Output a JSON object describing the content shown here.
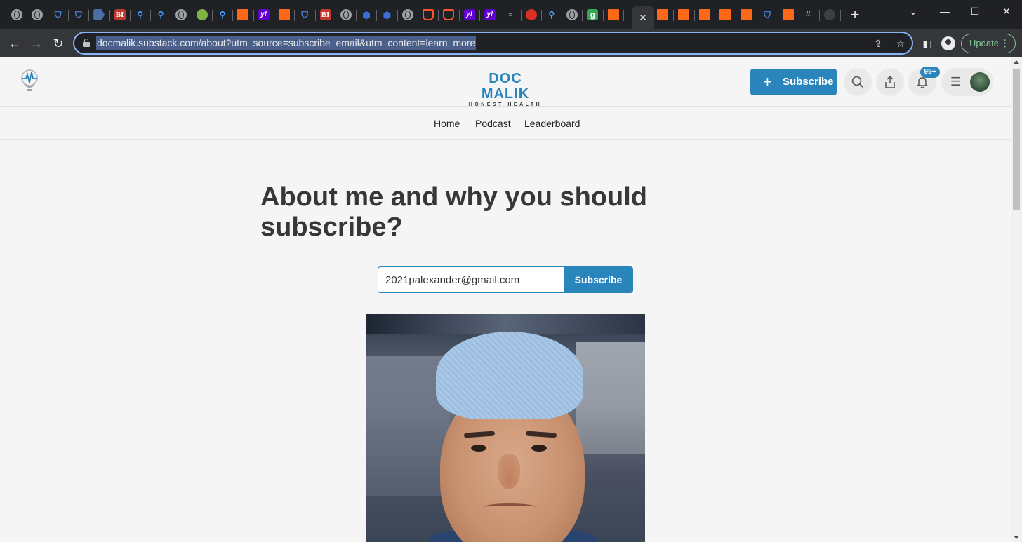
{
  "browser": {
    "tabs": [
      {
        "icon": "globe-icon"
      },
      {
        "icon": "globe-icon"
      },
      {
        "icon": "shield-icon"
      },
      {
        "icon": "shield-icon"
      },
      {
        "icon": "arrow-tag-icon"
      },
      {
        "icon": "business-insider-icon",
        "glyph": "BI"
      },
      {
        "icon": "search-icon"
      },
      {
        "icon": "search-icon"
      },
      {
        "icon": "globe-icon"
      },
      {
        "icon": "play-icon"
      },
      {
        "icon": "search-icon"
      },
      {
        "icon": "substack-icon"
      },
      {
        "icon": "yahoo-icon",
        "glyph": "y!"
      },
      {
        "icon": "substack-icon"
      },
      {
        "icon": "shield-icon"
      },
      {
        "icon": "business-insider-icon",
        "glyph": "BI"
      },
      {
        "icon": "globe-icon"
      },
      {
        "icon": "hexagon-icon"
      },
      {
        "icon": "hexagon-icon"
      },
      {
        "icon": "globe-icon"
      },
      {
        "icon": "brave-icon"
      },
      {
        "icon": "brave-icon"
      },
      {
        "icon": "yahoo-icon",
        "glyph": "y!"
      },
      {
        "icon": "yahoo-icon",
        "glyph": "y!"
      },
      {
        "icon": "grey-text-icon"
      },
      {
        "icon": "microphone-icon"
      },
      {
        "icon": "search-icon"
      },
      {
        "icon": "globe-icon"
      },
      {
        "icon": "g-icon",
        "glyph": "g"
      },
      {
        "icon": "substack-icon"
      }
    ],
    "active_tab_close": "✕",
    "tabs_after": [
      {
        "icon": "substack-icon"
      },
      {
        "icon": "substack-icon"
      },
      {
        "icon": "substack-icon"
      },
      {
        "icon": "substack-icon"
      },
      {
        "icon": "substack-icon"
      },
      {
        "icon": "shield-icon"
      },
      {
        "icon": "substack-icon"
      },
      {
        "icon": "slash-icon",
        "glyph": "//."
      },
      {
        "icon": "microphone-dark-icon"
      }
    ],
    "new_tab": "+",
    "window_controls": {
      "minimize": "—",
      "maximize": "☐",
      "close": "✕",
      "dropdown": "⌄"
    },
    "url": "docmalik.substack.com/about?utm_source=subscribe_email&utm_content=learn_more",
    "update_label": "Update"
  },
  "site": {
    "brand_title": "DOC MALIK",
    "brand_subtitle": "HONEST HEALTH",
    "subscribe_button": "Subscribe",
    "notification_badge": "99+",
    "nav": [
      "Home",
      "Podcast",
      "Leaderboard"
    ]
  },
  "content": {
    "heading": "About me and why you should subscribe?",
    "email_value": "2021palexander@gmail.com",
    "form_subscribe": "Subscribe"
  },
  "colors": {
    "accent": "#2a85bd",
    "heading": "#363737",
    "omnibox_focus": "#8ab4f8"
  }
}
